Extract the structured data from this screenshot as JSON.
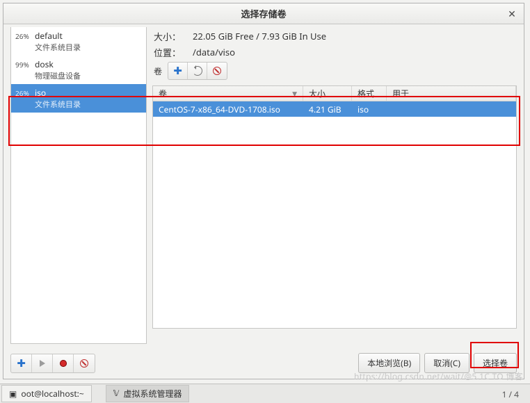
{
  "dialog": {
    "title": "选择存储卷",
    "close_glyph": "✕"
  },
  "pools": [
    {
      "pct": "26%",
      "name": "default",
      "desc": "文件系统目录"
    },
    {
      "pct": "99%",
      "name": "dosk",
      "desc": "物理磁盘设备"
    },
    {
      "pct": "26%",
      "name": "iso",
      "desc": "文件系统目录"
    }
  ],
  "info": {
    "size_label": "大小：",
    "size_value": "22.05 GiB Free / 7.93 GiB In Use",
    "location_label": "位置：",
    "location_value": "/data/viso",
    "volumes_label": "卷"
  },
  "toolbar": {
    "plus": "✚"
  },
  "table": {
    "headers": {
      "volume": "卷",
      "size": "大小",
      "format": "格式",
      "used_for": "用于"
    },
    "rows": [
      {
        "volume": "CentOS-7-x86_64-DVD-1708.iso",
        "size": "4.21 GiB",
        "format": "iso",
        "used_for": ""
      }
    ]
  },
  "footer": {
    "browse": "本地浏览(B)",
    "cancel": "取消(C)",
    "choose": "选择卷"
  },
  "taskbar": {
    "terminal": "oot@localhost:~",
    "vmm": "虚拟系统管理器"
  },
  "watermark": "https://blog.csdn.net/wait/@5.1C TO 博客",
  "pagenum": "1 / 4"
}
